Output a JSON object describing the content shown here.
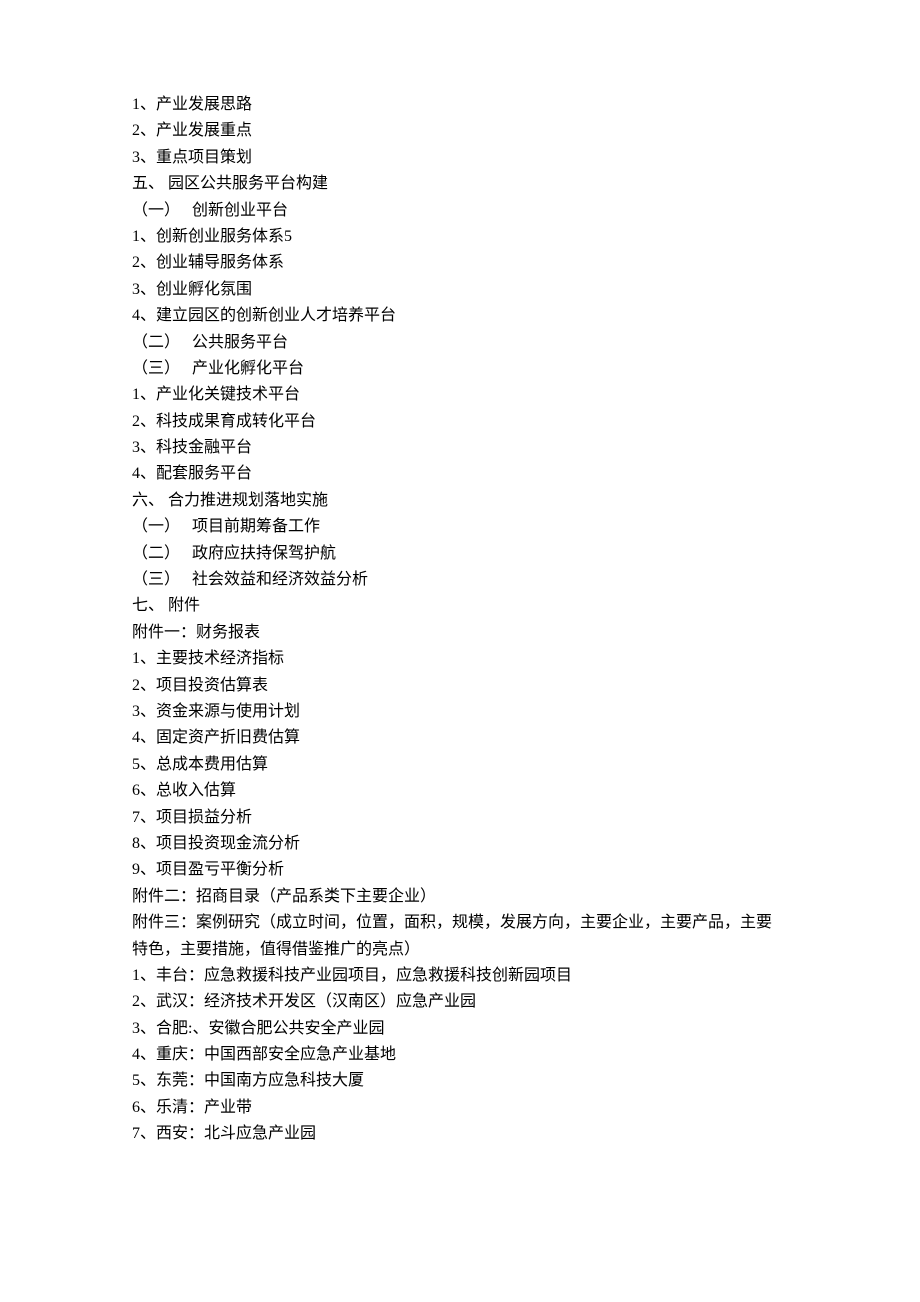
{
  "lines": [
    "1、产业发展思路",
    "2、产业发展重点",
    "3、重点项目策划",
    "五、 园区公共服务平台构建",
    "（一）　 创新创业平台",
    "1、创新创业服务体系5",
    "2、创业辅导服务体系",
    "3、创业孵化氛围",
    "4、建立园区的创新创业人才培养平台",
    "（二）　 公共服务平台",
    "（三）　 产业化孵化平台",
    "1、产业化关键技术平台",
    "2、科技成果育成转化平台",
    "3、科技金融平台",
    "4、配套服务平台",
    "六、 合力推进规划落地实施",
    "（一）　 项目前期筹备工作",
    "（二）　 政府应扶持保驾护航",
    "（三）　 社会效益和经济效益分析",
    "七、 附件",
    "附件一：财务报表",
    "1、主要技术经济指标",
    "2、项目投资估算表",
    "3、资金来源与使用计划",
    "4、固定资产折旧费估算",
    "5、总成本费用估算",
    "6、总收入估算",
    "7、项目损益分析",
    "8、项目投资现金流分析",
    "9、项目盈亏平衡分析",
    "附件二：招商目录（产品系类下主要企业）",
    "附件三：案例研究（成立时间，位置，面积，规模，发展方向，主要企业，主要产品，主要",
    "特色，主要措施，值得借鉴推广的亮点）",
    "1、丰台：应急救援科技产业园项目，应急救援科技创新园项目",
    "2、武汉：经济技术开发区（汉南区）应急产业园",
    "3、合肥:、安徽合肥公共安全产业园",
    "4、重庆：中国西部安全应急产业基地",
    "5、东莞：中国南方应急科技大厦",
    "6、乐清：产业带",
    "7、西安：北斗应急产业园"
  ]
}
